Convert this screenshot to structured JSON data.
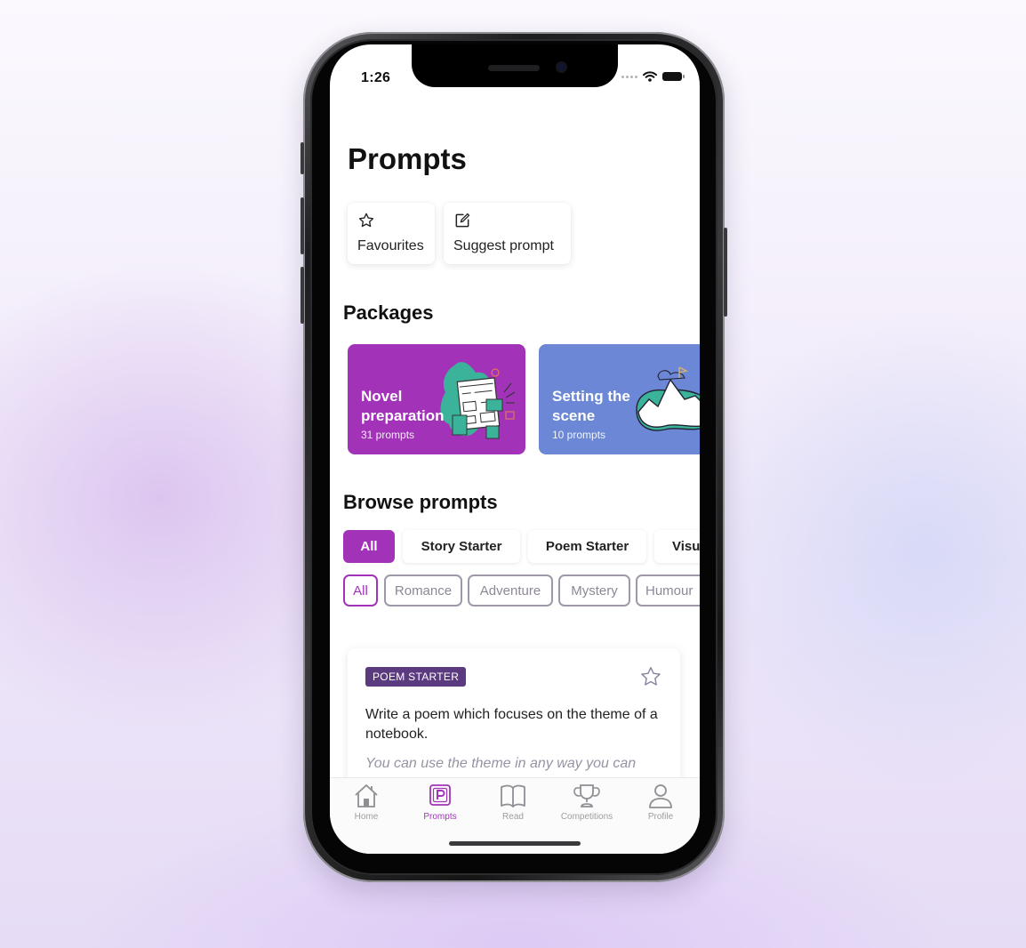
{
  "status_bar": {
    "time": "1:26"
  },
  "header": {
    "title": "Prompts"
  },
  "quick_actions": [
    {
      "label": "Favourites",
      "icon": "star-outline-icon"
    },
    {
      "label": "Suggest prompt",
      "icon": "edit-square-icon"
    }
  ],
  "packages": {
    "title": "Packages",
    "items": [
      {
        "title": "Novel preparation",
        "count": "31 prompts",
        "color": "#a233b8"
      },
      {
        "title": "Setting the scene",
        "count": "10 prompts",
        "color": "#6b87d6"
      }
    ]
  },
  "browse": {
    "title": "Browse prompts",
    "types": [
      "All",
      "Story Starter",
      "Poem Starter",
      "Visu"
    ],
    "active_type": "All",
    "genres": [
      "All",
      "Romance",
      "Adventure",
      "Mystery",
      "Humour"
    ],
    "active_genre": "All"
  },
  "prompt_card": {
    "badge": "POEM STARTER",
    "text": "Write a poem which focuses on the theme of a notebook.",
    "hint": "You can use the theme in any way you can"
  },
  "tabbar": {
    "items": [
      {
        "label": "Home",
        "icon": "home-icon"
      },
      {
        "label": "Prompts",
        "icon": "prompts-p-icon"
      },
      {
        "label": "Read",
        "icon": "book-icon"
      },
      {
        "label": "Competitions",
        "icon": "trophy-icon"
      },
      {
        "label": "Profile",
        "icon": "person-icon"
      }
    ],
    "active": "Prompts"
  },
  "colors": {
    "accent": "#a233b8",
    "badge": "#5b3a80",
    "package_blue": "#6b87d6"
  }
}
